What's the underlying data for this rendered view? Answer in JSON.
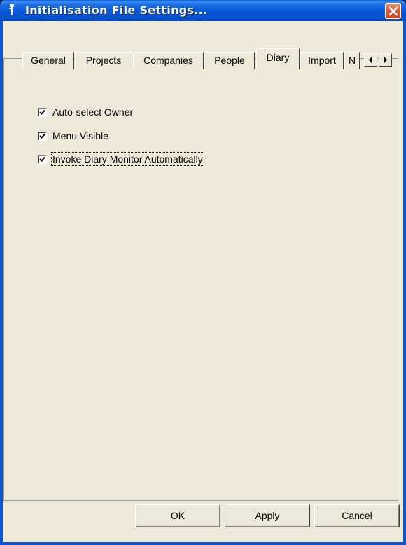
{
  "window": {
    "title": "Initialisation File Settings...",
    "title_bar_color": "#0858d6",
    "icons": {
      "app": "ini-file-icon",
      "close": "close-icon"
    }
  },
  "tabs": [
    {
      "label": "General",
      "selected": false
    },
    {
      "label": "Projects",
      "selected": false
    },
    {
      "label": "Companies",
      "selected": false
    },
    {
      "label": "People",
      "selected": false
    },
    {
      "label": "Diary",
      "selected": true
    },
    {
      "label": "Import",
      "selected": false
    },
    {
      "label": "N",
      "selected": false
    }
  ],
  "tab_scroll": {
    "left_icon": "scroll-left-icon",
    "right_icon": "scroll-right-icon"
  },
  "diary_settings": {
    "options": [
      {
        "label": "Auto-select Owner",
        "checked": true
      },
      {
        "label": "Menu Visible",
        "checked": true
      },
      {
        "label": "Invoke Diary Monitor Automatically",
        "checked": true,
        "focused": true
      }
    ]
  },
  "buttons": {
    "ok": "OK",
    "apply": "Apply",
    "cancel": "Cancel"
  }
}
